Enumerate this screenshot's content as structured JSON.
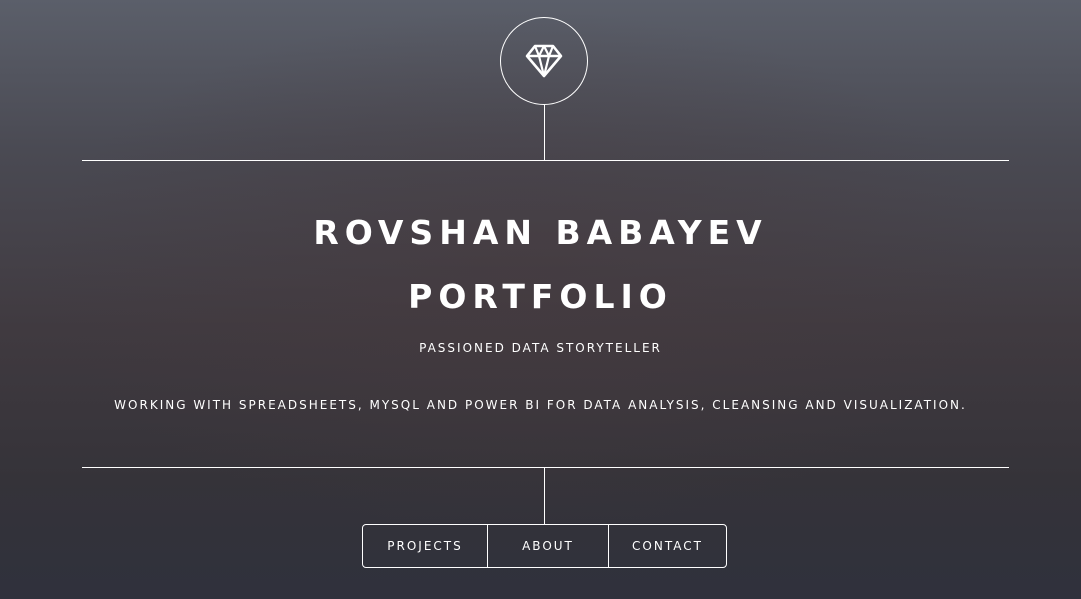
{
  "header": {
    "logo_icon": "diamond-icon",
    "title_line1": "ROVSHAN BABAYEV",
    "title_line2": "PORTFOLIO",
    "tagline": "PASSIONED DATA STORYTELLER",
    "description": "WORKING WITH SPREADSHEETS, MYSQL AND POWER BI FOR DATA ANALYSIS, CLEANSING AND VISUALIZATION."
  },
  "nav": {
    "items": [
      {
        "label": "PROJECTS"
      },
      {
        "label": "ABOUT"
      },
      {
        "label": "CONTACT"
      }
    ]
  },
  "colors": {
    "text": "#ffffff",
    "background_top": "#5b5f6a",
    "background_bottom": "#2f313c"
  }
}
